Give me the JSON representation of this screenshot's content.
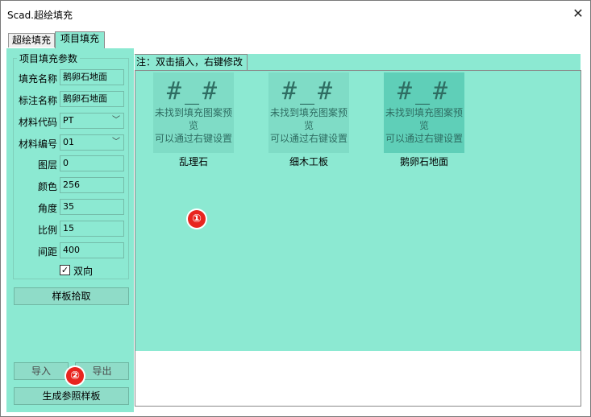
{
  "window": {
    "title": "Scad.超绘填充",
    "close_glyph": "✕"
  },
  "tabs": [
    {
      "label": "超绘填充"
    },
    {
      "label": "项目填充"
    }
  ],
  "params": {
    "group_title": "项目填充参数",
    "fill_name": {
      "label": "填充名称",
      "value": "鹅卵石地面"
    },
    "mark_name": {
      "label": "标注名称",
      "value": "鹅卵石地面"
    },
    "material_code": {
      "label": "材料代码",
      "value": "PT"
    },
    "material_no": {
      "label": "材料编号",
      "value": "01"
    },
    "layer": {
      "label": "图层",
      "value": "0"
    },
    "color": {
      "label": "颜色",
      "value": "256"
    },
    "angle": {
      "label": "角度",
      "value": "35"
    },
    "scale": {
      "label": "比例",
      "value": "15"
    },
    "spacing": {
      "label": "间距",
      "value": "400"
    },
    "bidirectional": {
      "label": "双向",
      "checked": true,
      "mark": "✓"
    },
    "pick_button": "样板拾取"
  },
  "bottom": {
    "import": "导入",
    "export": "导出",
    "generate": "生成参照样板"
  },
  "list": {
    "hint": "注：双击插入，右键修改",
    "tiles": [
      {
        "glyph": "#_#",
        "line1": "未找到填充图案预览",
        "line2": "可以通过右键设置",
        "label": "乱理石"
      },
      {
        "glyph": "#_#",
        "line1": "未找到填充图案预览",
        "line2": "可以通过右键设置",
        "label": "细木工板"
      },
      {
        "glyph": "#_#",
        "line1": "未找到填充图案预览",
        "line2": "可以通过右键设置",
        "label": "鹅卵石地面"
      }
    ]
  },
  "markers": [
    "①",
    "②"
  ],
  "colors": {
    "accent": "#8ce9d2",
    "marker": "#e8251f"
  }
}
